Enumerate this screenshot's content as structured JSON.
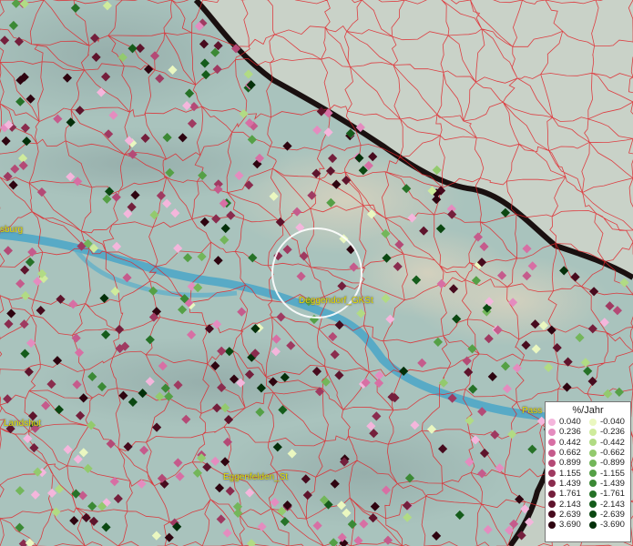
{
  "map": {
    "places": [
      {
        "name": "Deggendorf_GKSt",
        "label": "Deggendorf_GKSt"
      },
      {
        "name": "sburg",
        "label": "sburg"
      },
      {
        "name": "Landshut",
        "label": "Landshut"
      },
      {
        "name": "Eggenfelden_St",
        "label": "Eggenfelden_St"
      },
      {
        "name": "Pass",
        "label": "Pass"
      }
    ]
  },
  "legend": {
    "title": "%/Jahr",
    "positive": [
      {
        "value": "0.040",
        "color": "#f4b6dc"
      },
      {
        "value": "0.236",
        "color": "#e48cbf"
      },
      {
        "value": "0.442",
        "color": "#d76fa4"
      },
      {
        "value": "0.662",
        "color": "#c55b8c"
      },
      {
        "value": "0.899",
        "color": "#b44a76"
      },
      {
        "value": "1.155",
        "color": "#9f3a61"
      },
      {
        "value": "1.439",
        "color": "#8a2c4e"
      },
      {
        "value": "1.761",
        "color": "#741f3c"
      },
      {
        "value": "2.143",
        "color": "#5e142c"
      },
      {
        "value": "2.639",
        "color": "#470b1e"
      },
      {
        "value": "3.690",
        "color": "#2e0410"
      }
    ],
    "negative": [
      {
        "value": "-0.040",
        "color": "#eaf7c0"
      },
      {
        "value": "-0.236",
        "color": "#cfeb9c"
      },
      {
        "value": "-0.442",
        "color": "#b1db84"
      },
      {
        "value": "-0.662",
        "color": "#93ca6e"
      },
      {
        "value": "-0.899",
        "color": "#73b65a"
      },
      {
        "value": "-1.155",
        "color": "#55a046"
      },
      {
        "value": "-1.439",
        "color": "#3b8935"
      },
      {
        "value": "-1.761",
        "color": "#267227"
      },
      {
        "value": "-2.143",
        "color": "#155c1b"
      },
      {
        "value": "-2.639",
        "color": "#0b4812"
      },
      {
        "value": "-3.690",
        "color": "#04300a"
      }
    ]
  }
}
